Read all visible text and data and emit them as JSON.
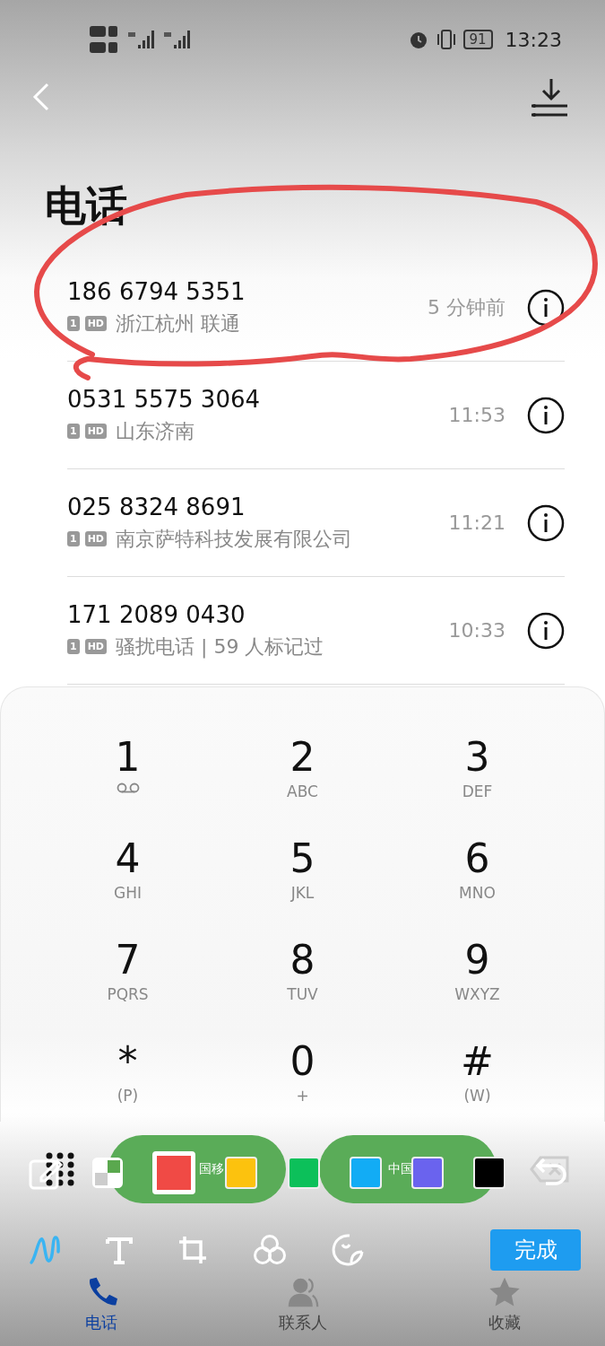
{
  "status_bar": {
    "battery": "91",
    "time": "13:23"
  },
  "header": {
    "title": "电话"
  },
  "calls": [
    {
      "number": "186 6794 5351",
      "badges": [
        "1",
        "HD"
      ],
      "location": "浙江杭州 联通",
      "time": "5 分钟前",
      "annotated": true
    },
    {
      "number": "0531 5575 3064",
      "badges": [
        "1",
        "HD"
      ],
      "location": "山东济南",
      "time": "11:53",
      "annotated": false
    },
    {
      "number": "025 8324 8691",
      "badges": [
        "1",
        "HD"
      ],
      "location": "南京萨特科技发展有限公司",
      "time": "11:21",
      "annotated": false
    },
    {
      "number": "171 2089 0430",
      "badges": [
        "1",
        "HD"
      ],
      "location": "骚扰电话 | 59 人标记过",
      "time": "10:33",
      "annotated": false
    }
  ],
  "dialpad": [
    {
      "digit": "1",
      "kind": "voicemail"
    },
    {
      "digit": "2",
      "kind": "letters",
      "letters": "ABC"
    },
    {
      "digit": "3",
      "kind": "letters",
      "letters": "DEF"
    },
    {
      "digit": "4",
      "kind": "letters",
      "letters": "GHI"
    },
    {
      "digit": "5",
      "kind": "letters",
      "letters": "JKL"
    },
    {
      "digit": "6",
      "kind": "letters",
      "letters": "MNO"
    },
    {
      "digit": "7",
      "kind": "letters",
      "letters": "PQRS"
    },
    {
      "digit": "8",
      "kind": "letters",
      "letters": "TUV"
    },
    {
      "digit": "9",
      "kind": "letters",
      "letters": "WXYZ"
    },
    {
      "digit": "*",
      "kind": "letters",
      "letters": "(P)"
    },
    {
      "digit": "0",
      "kind": "letters",
      "letters": "+"
    },
    {
      "digit": "#",
      "kind": "letters",
      "letters": "(W)"
    }
  ],
  "call_buttons": [
    {
      "label": "国移"
    },
    {
      "label": "中国"
    }
  ],
  "markup": {
    "swatches": [
      {
        "color": "#f04a45",
        "selected": true
      },
      {
        "color": "#fcc20e",
        "selected": false
      },
      {
        "color": "#0cc05a",
        "selected": false
      },
      {
        "color": "#12acf5",
        "selected": false
      },
      {
        "color": "#6a63ee",
        "selected": false
      },
      {
        "color": "#000000",
        "selected": false
      }
    ],
    "tools": [
      {
        "kind": "pen",
        "selected": true
      },
      {
        "kind": "text",
        "selected": false
      },
      {
        "kind": "crop",
        "selected": false
      },
      {
        "kind": "filter",
        "selected": false
      },
      {
        "kind": "sticker",
        "selected": false
      }
    ],
    "done_button": "完成"
  },
  "nav": [
    {
      "label": "电话",
      "kind": "phone",
      "selected": true
    },
    {
      "label": "联系人",
      "kind": "contacts",
      "selected": false
    },
    {
      "label": "收藏",
      "kind": "star",
      "selected": false
    }
  ]
}
